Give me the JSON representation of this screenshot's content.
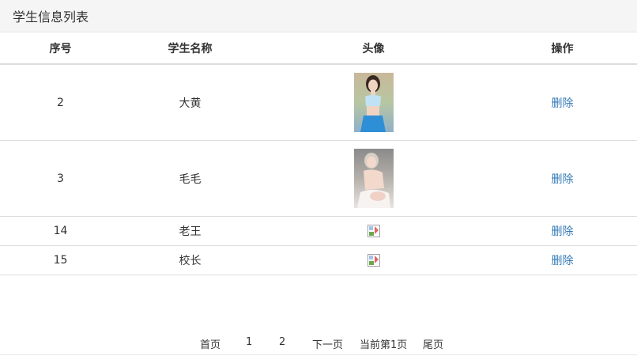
{
  "header": {
    "title": "学生信息列表"
  },
  "table": {
    "columns": [
      "序号",
      "学生名称",
      "头像",
      "操作"
    ],
    "rows": [
      {
        "id": "2",
        "name": "大黄",
        "avatar": "photo",
        "action": "删除"
      },
      {
        "id": "3",
        "name": "毛毛",
        "avatar": "photo",
        "action": "删除"
      },
      {
        "id": "14",
        "name": "老王",
        "avatar": "broken-image-icon",
        "action": "删除"
      },
      {
        "id": "15",
        "name": "校长",
        "avatar": "broken-image-icon",
        "action": "删除"
      }
    ]
  },
  "pagination": {
    "first": "首页",
    "page1": "1",
    "page2": "2",
    "next": "下一页",
    "current": "当前第1页",
    "last": "尾页"
  },
  "colors": {
    "link": "#337ab7",
    "border": "#dddddd",
    "header_bg": "#f5f5f5"
  }
}
